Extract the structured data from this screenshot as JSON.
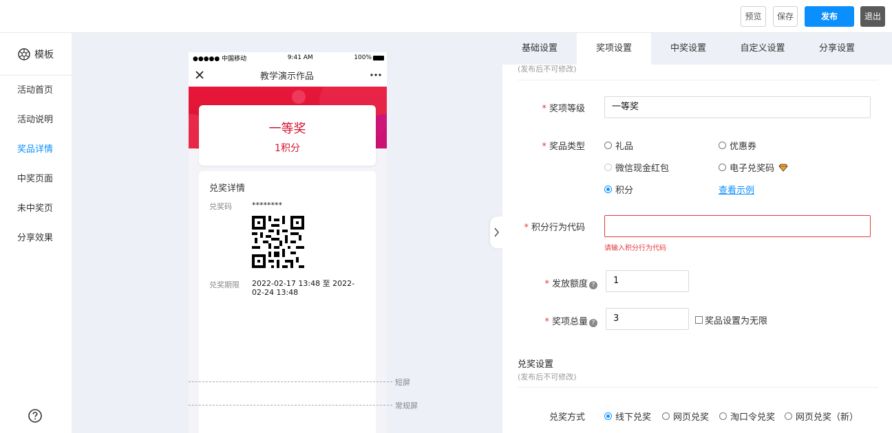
{
  "toolbar": {
    "preview_label": "预览",
    "save_label": "保存",
    "publish_label": "发布",
    "exit_label": "退出"
  },
  "sidebar": {
    "template_label": "模板",
    "items": [
      {
        "label": "活动首页",
        "active": false
      },
      {
        "label": "活动说明",
        "active": false
      },
      {
        "label": "奖品详情",
        "active": true
      },
      {
        "label": "中奖页面",
        "active": false
      },
      {
        "label": "未中奖页",
        "active": false
      },
      {
        "label": "分享效果",
        "active": false
      }
    ],
    "help_icon": "question-circle-icon"
  },
  "phone": {
    "carrier": "●●●●● 中国移动",
    "time": "9:41 AM",
    "battery": "100%",
    "title": "教学演示作品",
    "prize_name": "一等奖",
    "prize_points": "1积分",
    "detail_title": "兑奖详情",
    "code_label": "兑奖码",
    "code_value": "********",
    "period_label": "兑奖期限",
    "period_value": "2022-02-17 13:48 至 2022-02-24 13:48"
  },
  "screen_markers": {
    "short": "短屏",
    "regular": "常规屏"
  },
  "tabs": [
    {
      "label": "基础设置",
      "active": false
    },
    {
      "label": "奖项设置",
      "active": true
    },
    {
      "label": "中奖设置",
      "active": false
    },
    {
      "label": "自定义设置",
      "active": false
    },
    {
      "label": "分享设置",
      "active": false
    }
  ],
  "form": {
    "top_note": "(发布后不可修改)",
    "level_label": "奖项等级",
    "level_value": "一等奖",
    "type_label": "奖品类型",
    "type_options": {
      "gift": "礼品",
      "coupon": "优惠券",
      "wechat_red": "微信现金红包",
      "ecode": "电子兑奖码",
      "points": "积分"
    },
    "view_example": "查看示例",
    "points_code_label": "积分行为代码",
    "points_code_value": "",
    "points_code_error": "请输入积分行为代码",
    "amount_label": "发放额度",
    "amount_value": "1",
    "total_label": "奖项总量",
    "total_value": "3",
    "unlimited_label": "奖品设置为无限",
    "redeem_section_title": "兑奖设置",
    "redeem_note": "(发布后不可修改)",
    "redeem_method_label": "兑奖方式",
    "redeem_options": {
      "offline": "线下兑奖",
      "web": "网页兑奖",
      "taobao": "淘口令兑奖",
      "web_new": "网页兑奖（新）"
    }
  },
  "colors": {
    "accent": "#0a8ffc",
    "prize_red": "#d4122e",
    "error": "#e4393c"
  }
}
